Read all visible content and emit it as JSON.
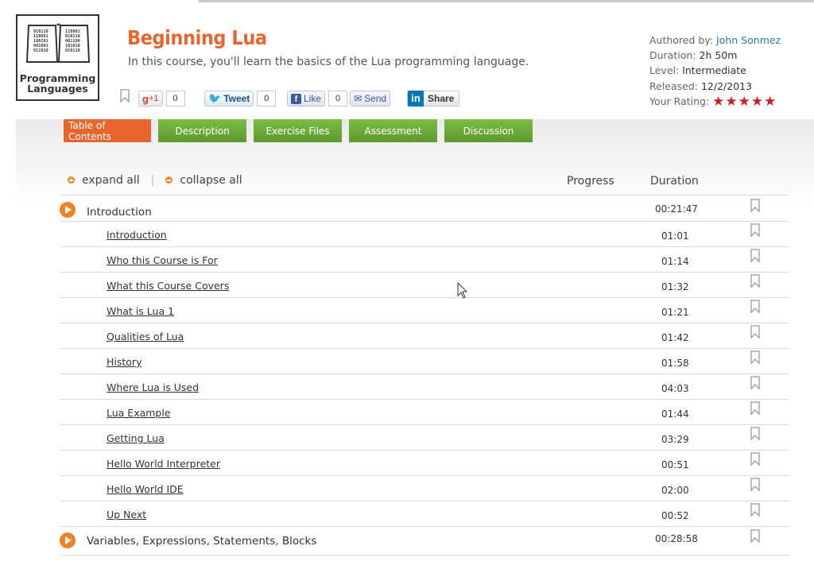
{
  "logo": {
    "line1": "Programming",
    "line2": "Languages",
    "icon": "book-binary-icon"
  },
  "course": {
    "title": "Beginning Lua",
    "description": "In this course, you'll learn the basics of the Lua programming language."
  },
  "social": {
    "gplus_label": "+1",
    "gplus_g": "g",
    "gplus_count": "0",
    "tweet_label": "Tweet",
    "tweet_count": "0",
    "like_label": "Like",
    "like_count": "0",
    "send_label": "Send",
    "linkedin_label": "Share",
    "linkedin_in": "in"
  },
  "meta": {
    "authored_label": "Authored by:",
    "author": "John Sonmez",
    "duration_label": "Duration:",
    "duration": "2h 50m",
    "level_label": "Level:",
    "level": "Intermediate",
    "released_label": "Released:",
    "released": "12/2/2013",
    "rating_label": "Your Rating:",
    "rating_stars": "★★★★★",
    "rating_value": 5
  },
  "tabs": [
    "Table of Contents",
    "Description",
    "Exercise Files",
    "Assessment",
    "Discussion"
  ],
  "controls": {
    "expand": "expand all",
    "collapse": "collapse all",
    "separator": "|"
  },
  "headers": {
    "progress": "Progress",
    "duration": "Duration"
  },
  "modules": [
    {
      "title": "Introduction",
      "duration": "00:21:47",
      "clips": [
        {
          "title": "Introduction",
          "duration": "01:01"
        },
        {
          "title": "Who this Course is For",
          "duration": "01:14"
        },
        {
          "title": "What this Course Covers",
          "duration": "01:32"
        },
        {
          "title": "What is Lua 1",
          "duration": "01:21"
        },
        {
          "title": "Qualities of Lua",
          "duration": "01:42"
        },
        {
          "title": "History",
          "duration": "01:58"
        },
        {
          "title": "Where Lua is Used",
          "duration": "04:03"
        },
        {
          "title": "Lua Example",
          "duration": "01:44"
        },
        {
          "title": "Getting Lua",
          "duration": "03:29"
        },
        {
          "title": "Hello World Interpreter",
          "duration": "00:51"
        },
        {
          "title": "Hello World IDE",
          "duration": "02:00"
        },
        {
          "title": "Up Next",
          "duration": "00:52"
        }
      ]
    },
    {
      "title": "Variables, Expressions, Statements, Blocks",
      "duration": "00:28:58",
      "clips": []
    }
  ],
  "colors": {
    "accent": "#e8662d",
    "tab_green": "#6aa935",
    "star": "#cc1f1f",
    "link": "#2a7bb8"
  }
}
